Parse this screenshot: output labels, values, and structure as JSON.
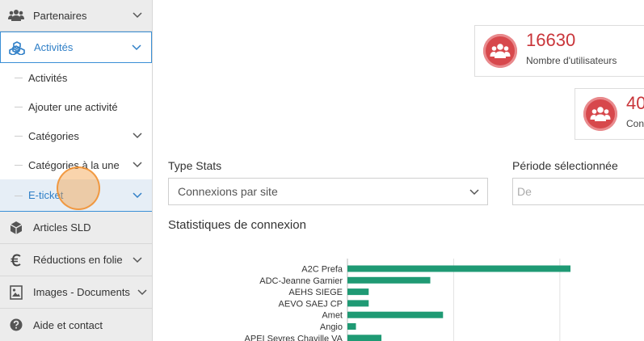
{
  "sidebar": {
    "items": [
      {
        "label": "Partenaires",
        "icon": "users-icon"
      },
      {
        "label": "Activités",
        "icon": "cubes-icon"
      },
      {
        "label": "Articles SLD",
        "icon": "cube-icon"
      },
      {
        "label": "Réductions en folie",
        "icon": "euro-icon"
      },
      {
        "label": "Images - Documents",
        "icon": "image-icon"
      },
      {
        "label": "Aide et contact",
        "icon": "question-icon"
      }
    ],
    "subitems": [
      {
        "label": "Activités"
      },
      {
        "label": "Ajouter une activité"
      },
      {
        "label": "Catégories"
      },
      {
        "label": "Catégories à la une"
      },
      {
        "label": "E-ticket"
      }
    ]
  },
  "stats": [
    {
      "value": "16630",
      "caption": "Nombre d'utilisateurs"
    },
    {
      "value": "40",
      "caption": "Con"
    }
  ],
  "filters": {
    "type_label": "Type Stats",
    "type_value": "Connexions par site",
    "period_label": "Période sélectionnée",
    "period_placeholder": "De"
  },
  "chart_title": "Statistiques de connexion",
  "colors": {
    "accent": "#2f7fc7",
    "stat_red": "#c9353a",
    "bar": "#1f9a74"
  },
  "chart_data": {
    "type": "bar",
    "orientation": "horizontal",
    "categories": [
      "A2C Prefa",
      "ADC-Jeanne Garnier",
      "AEHS SIEGE",
      "AEVO SAEJ CP",
      "Amet",
      "Angio",
      "APEI Sevres Chaville VA"
    ],
    "values": [
      1050,
      390,
      100,
      100,
      450,
      40,
      160
    ],
    "xlim": [
      0,
      1400
    ],
    "gridlines": [
      0,
      500,
      1000
    ]
  }
}
